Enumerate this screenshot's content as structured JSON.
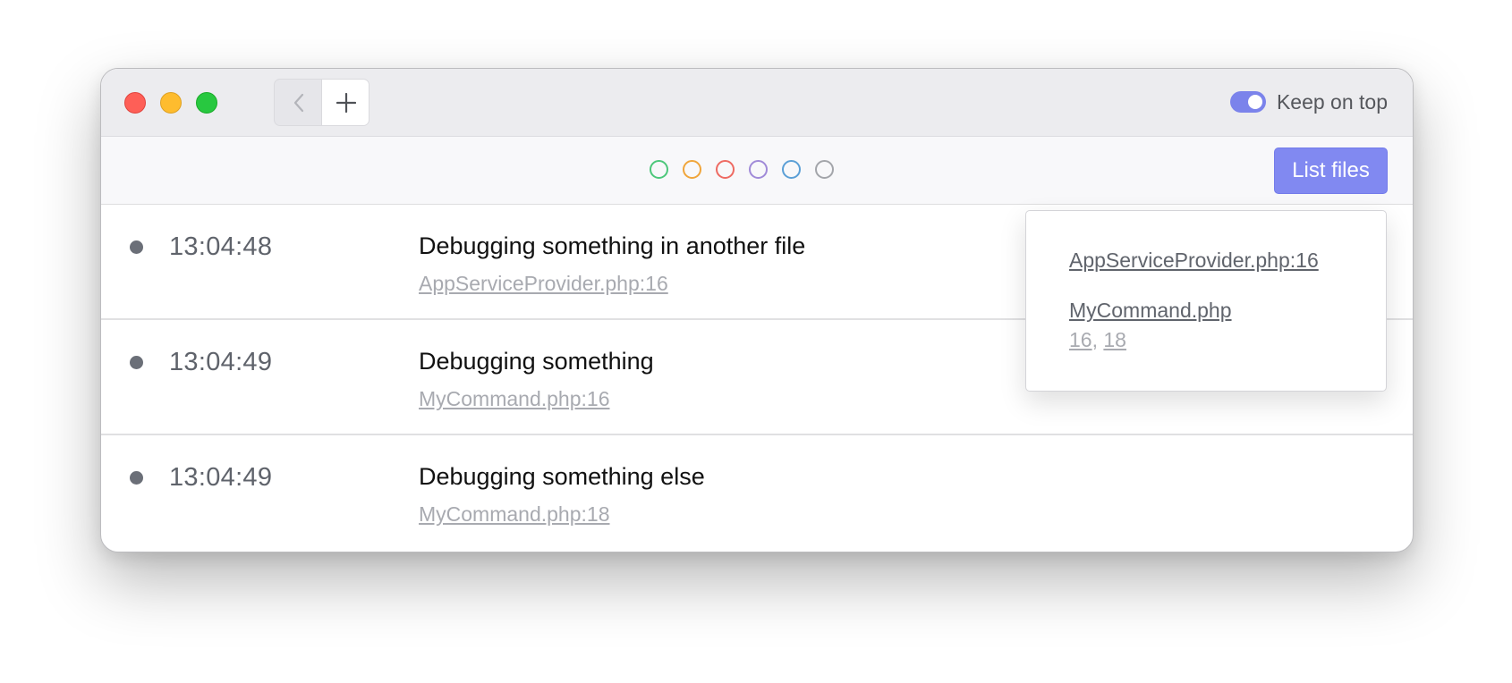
{
  "titlebar": {
    "back_icon": "chevron-left-icon",
    "add_icon": "plus-icon",
    "keep_on_top": {
      "label": "Keep on top",
      "enabled": true,
      "color": "#7b83eb"
    }
  },
  "toolbar": {
    "color_filters": [
      {
        "name": "green",
        "color": "#4cc77a"
      },
      {
        "name": "orange",
        "color": "#f0a53a"
      },
      {
        "name": "red",
        "color": "#ee6a62"
      },
      {
        "name": "purple",
        "color": "#a08ad8"
      },
      {
        "name": "blue",
        "color": "#5b9fd6"
      },
      {
        "name": "gray",
        "color": "#a3a5aa"
      }
    ],
    "list_files_label": "List files",
    "accent": "#8189f1"
  },
  "entries": [
    {
      "time": "13:04:48",
      "message": "Debugging something in another file",
      "file": "AppServiceProvider.php:16"
    },
    {
      "time": "13:04:49",
      "message": "Debugging something",
      "file": "MyCommand.php:16"
    },
    {
      "time": "13:04:49",
      "message": "Debugging something else",
      "file": "MyCommand.php:18"
    }
  ],
  "files_popover": {
    "files": [
      {
        "name": "AppServiceProvider.php:16"
      },
      {
        "name": "MyCommand.php",
        "lines": [
          "16",
          "18"
        ],
        "separator": ","
      }
    ]
  }
}
